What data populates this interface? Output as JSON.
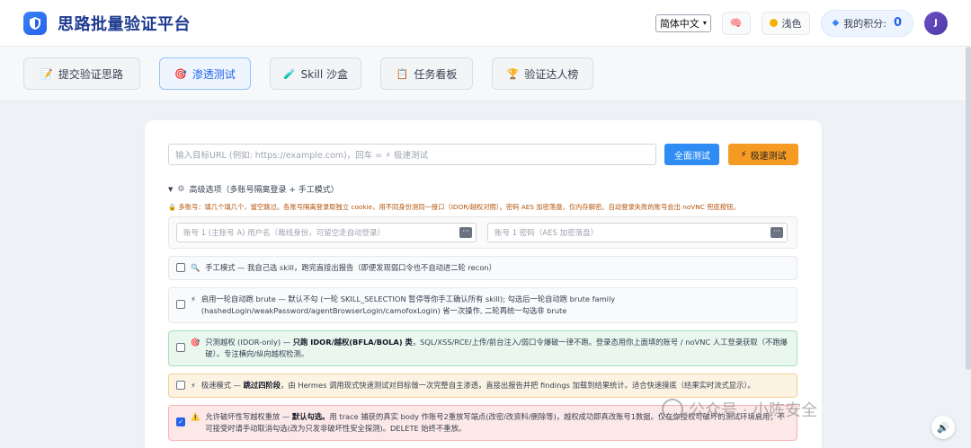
{
  "header": {
    "title": "思路批量验证平台",
    "language": "简体中文",
    "theme_label": "浅色",
    "points_label": "我的积分:",
    "points_value": "0",
    "avatar_initial": "J"
  },
  "tabs": [
    {
      "label": "提交验证思路",
      "icon": "📝"
    },
    {
      "label": "渗透测试",
      "icon": "🎯"
    },
    {
      "label": "Skill 沙盒",
      "icon": "🧪"
    },
    {
      "label": "任务看板",
      "icon": "📋"
    },
    {
      "label": "验证达人榜",
      "icon": "🏆"
    }
  ],
  "form": {
    "url_placeholder": "输入目标URL (例如: https://example.com)，回车 = ⚡ 极速测试",
    "full_test_label": "全面测试",
    "fast_test_label": "极速测试",
    "advanced_title": "高级选项（多账号隔离登录 + 手工模式）",
    "advanced_note": "多账号：填几个填几个，留空跳过。各账号隔离登录取独立 cookie，用不同身份测同一接口（IDOR/越权对照）。密码 AES 加密落盘，仅内存解密。自动登录失败的账号会出 noVNC 兜底按钮。",
    "account_user_placeholder": "账号 1 (主账号 A) 用户名（裁线身份，可留空走自动登录）",
    "account_pass_placeholder": "账号 1 密码（AES 加密落盘）"
  },
  "options": [
    {
      "checked": false,
      "icon": "🔍",
      "text": "手工模式 — 我自己选 skill，跑完直接出报告（即便发现弱口令也不自动进二轮 recon）",
      "bold": "",
      "text_after": ""
    },
    {
      "checked": false,
      "icon": "⚡",
      "text": "启用一轮自动跑 brute — 默认不勾 (一轮 SKILL_SELECTION 暂停等你手工确认所有 skill); 勾选后一轮自动跑 brute family (hashedLogin/weakPassword/agentBrowserLogin/camofoxLogin) 省一次操作, 二轮再统一勾选非 brute",
      "bold": "",
      "text_after": ""
    },
    {
      "checked": false,
      "icon": "🎯",
      "text": "只测越权 (IDOR-only) — ",
      "bold": "只跑 IDOR/越权(BFLA/BOLA) 类",
      "text_after": "，SQL/XSS/RCE/上传/前台注入/弱口令爆破一律不跑。登录态用你上面填的账号 / noVNC 人工登录获取（不跑爆破）。专注横向/纵向越权检测。"
    },
    {
      "checked": false,
      "icon": "⚡",
      "text": "极速模式 — ",
      "bold": "跳过四阶段",
      "text_after": "，由 Hermes 调用现式快速测试对目标做一次完整自主渗透，直接出报告并把 findings 加载到结果统计。适合快速摸底（结果实时流式显示）。"
    },
    {
      "checked": true,
      "icon": "⚠️",
      "text": "允许破坏性写越权重放 — ",
      "bold": "默认勾选。",
      "text_after": "用 trace 捕获的真实 body 作账号2重放写端点(改密/改资料/删除等)，越权成功即真改账号1数据。仅在你授权可破坏的测试环境启用；不可接受时请手动取消勾选(改为只发非破坏性安全探测)。DELETE 始终不重放。"
    }
  ],
  "watermark": "公众号 · 小陈安全",
  "colors": {
    "accent": "#2f8cf3",
    "fast": "#f59a23",
    "brand": "#1f3b8f"
  }
}
